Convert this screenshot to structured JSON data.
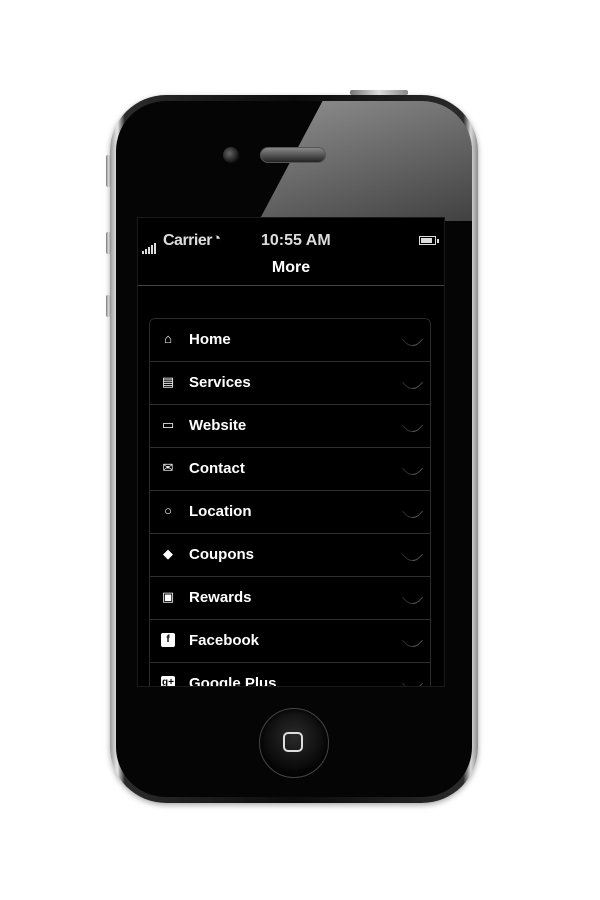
{
  "status_bar": {
    "carrier": "Carrier",
    "time": "10:55 AM"
  },
  "nav": {
    "title": "More"
  },
  "menu": {
    "items": [
      {
        "label": "Home",
        "icon": "home-icon"
      },
      {
        "label": "Services",
        "icon": "document-icon"
      },
      {
        "label": "Website",
        "icon": "laptop-icon"
      },
      {
        "label": "Contact",
        "icon": "envelope-icon"
      },
      {
        "label": "Location",
        "icon": "map-pin-icon"
      },
      {
        "label": "Coupons",
        "icon": "tag-icon"
      },
      {
        "label": "Rewards",
        "icon": "gift-icon"
      },
      {
        "label": "Facebook",
        "icon": "facebook-icon"
      },
      {
        "label": "Google Plus",
        "icon": "google-plus-icon"
      }
    ]
  },
  "icon_glyphs": {
    "facebook": "f",
    "google_plus": "g+"
  },
  "colors": {
    "screen_background": "#000000",
    "text": "#ffffff",
    "divider": "#2f2f2f"
  }
}
